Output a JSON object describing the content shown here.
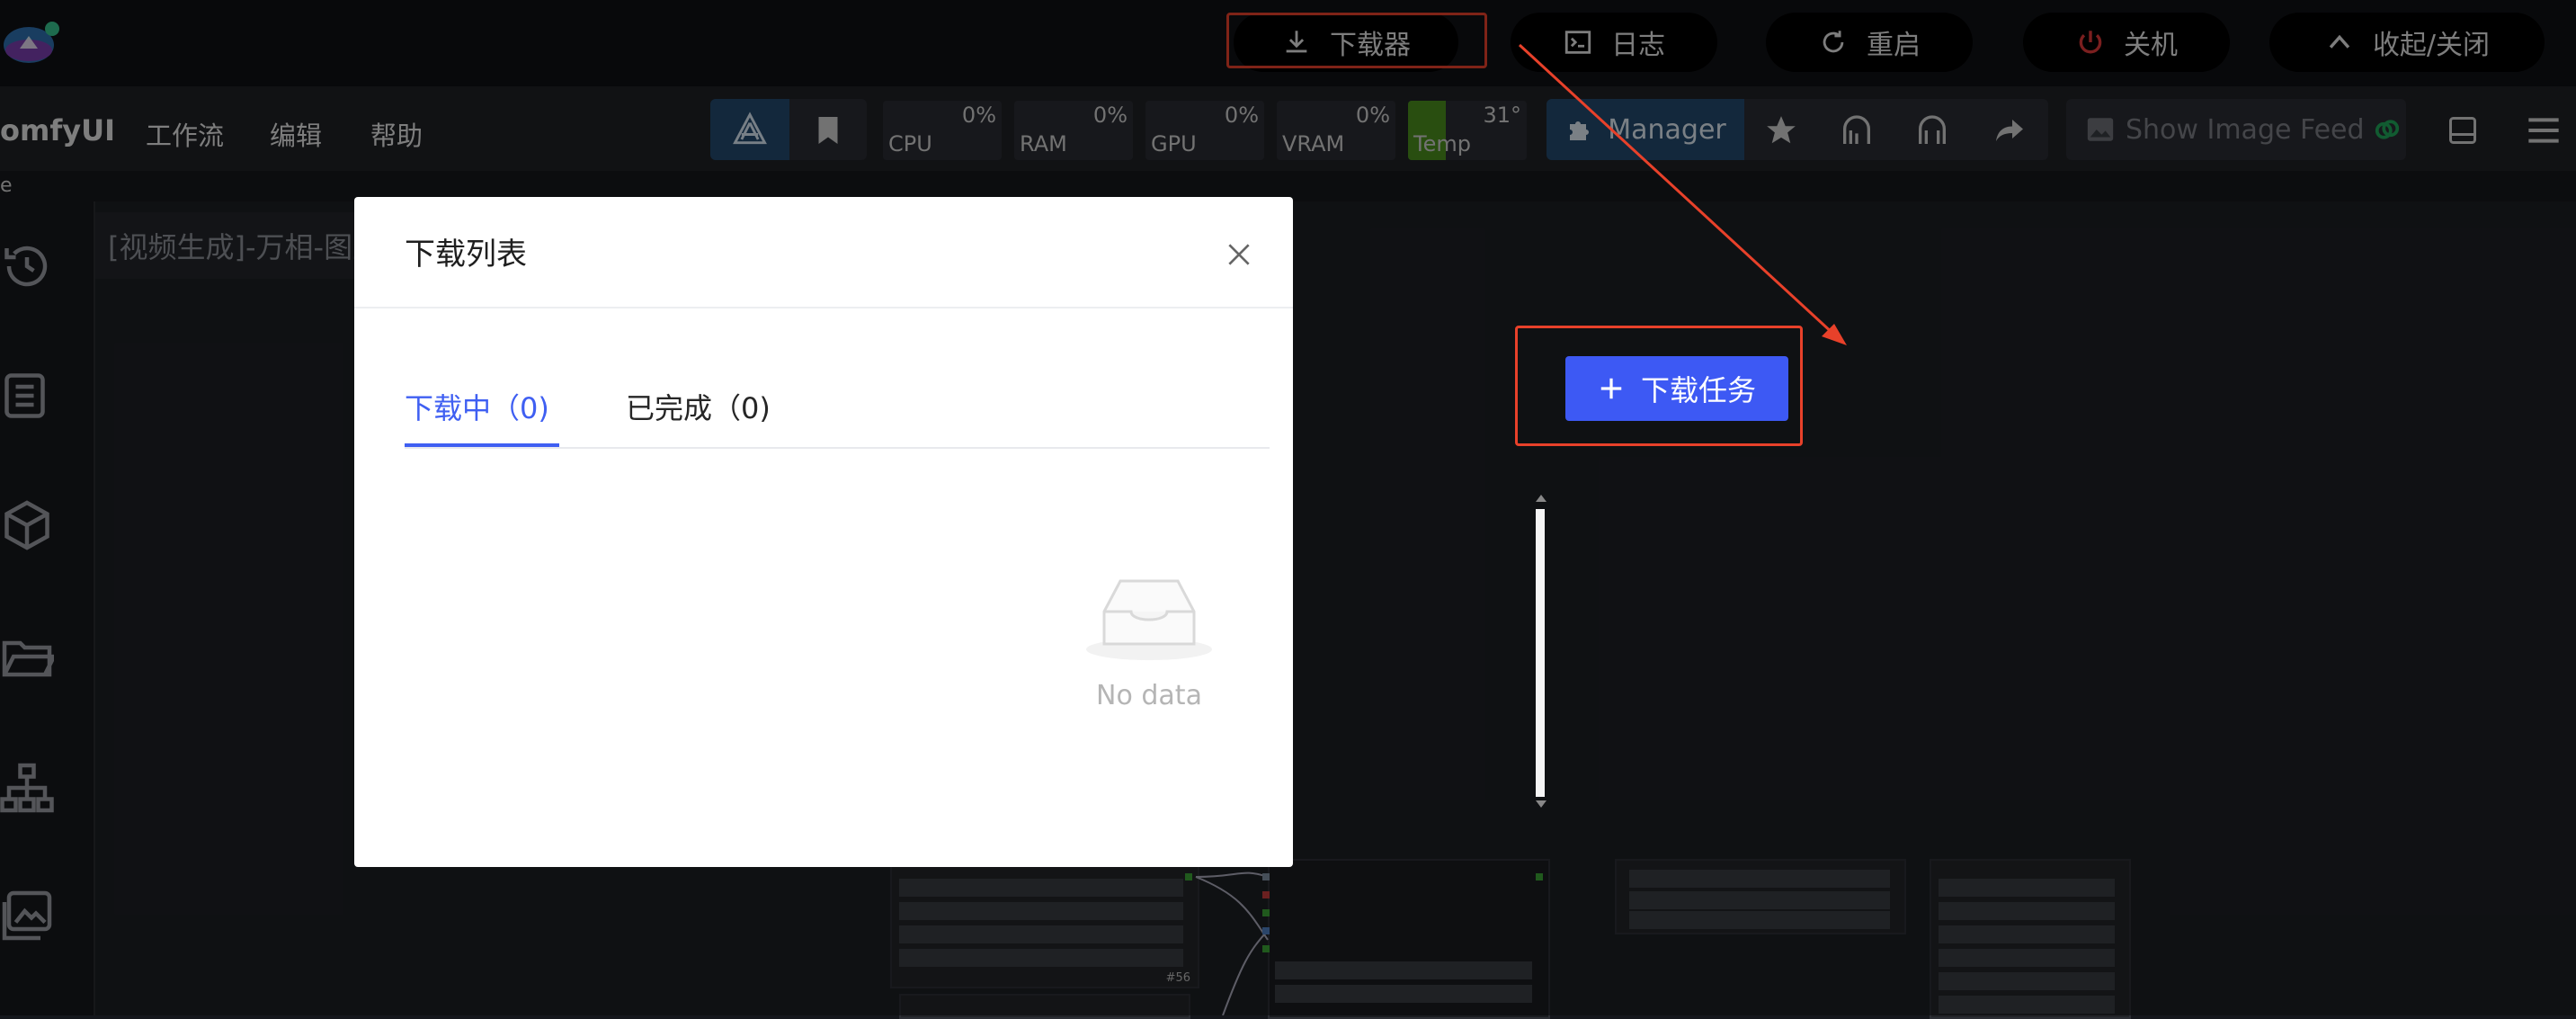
{
  "header": {
    "buttons": [
      {
        "label": "下载器",
        "icon": "download-icon"
      },
      {
        "label": "日志",
        "icon": "terminal-icon"
      },
      {
        "label": "重启",
        "icon": "restart-icon"
      },
      {
        "label": "关机",
        "icon": "power-icon"
      },
      {
        "label": "收起/关闭",
        "icon": "chevron-up-icon"
      }
    ]
  },
  "menubar": {
    "app_name": "omfyUI",
    "menus": [
      "工作流",
      "编辑",
      "帮助"
    ],
    "stats": [
      {
        "label": "CPU",
        "value": "0%"
      },
      {
        "label": "RAM",
        "value": "0%"
      },
      {
        "label": "GPU",
        "value": "0%"
      },
      {
        "label": "VRAM",
        "value": "0%"
      },
      {
        "label": "Temp",
        "value": "31°"
      }
    ],
    "manager_label": "Manager",
    "image_feed_label": "Show Image Feed"
  },
  "strip": {
    "text": "e"
  },
  "workflow": {
    "tab_title": "[视频生成]-万相-图生"
  },
  "canvas": {
    "node_badge": "#56"
  },
  "modal": {
    "title": "下载列表",
    "tabs": [
      {
        "label": "下载中（0)"
      },
      {
        "label": "已完成（0)"
      }
    ],
    "add_task_label": "下载任务",
    "empty_text": "No data"
  },
  "colors": {
    "accent": "#3f5ff2",
    "highlight": "#e8412a",
    "danger": "#e03a3a"
  }
}
